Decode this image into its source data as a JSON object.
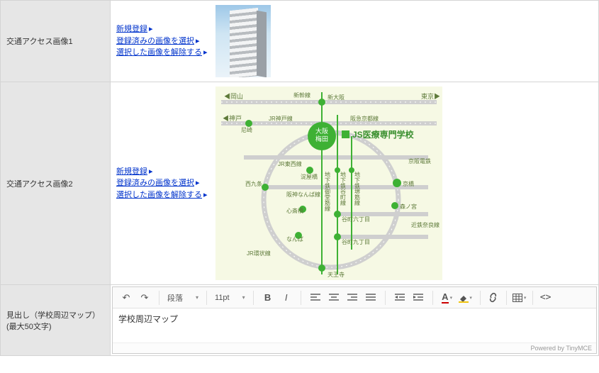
{
  "rows": {
    "access1": {
      "label": "交通アクセス画像1"
    },
    "access2": {
      "label": "交通アクセス画像2"
    },
    "heading": {
      "label": "見出し（学校周辺マップ）(最大50文字)"
    }
  },
  "links": {
    "new": "新規登録",
    "choose": "登録済みの画像を選択",
    "clear": "選択した画像を解除する"
  },
  "editor": {
    "undo": "↶",
    "redo": "↷",
    "para": "段落",
    "size": "11pt",
    "bold": "B",
    "italic": "I",
    "content": "学校周辺マップ",
    "footer": "Powered by TinyMCE"
  },
  "map": {
    "title": "JS医療専門学校",
    "center": "大阪・梅田",
    "dirs": {
      "w": "◀岡山",
      "e": "東京▶",
      "kobe": "◀神戸"
    },
    "lines": {
      "shinkansen": "新幹線",
      "jrkobe": "JR神戸線",
      "hankyu": "阪急京都線",
      "jrtozai": "JR東西線",
      "hanshin": "阪神なんば線",
      "jrkanjo": "JR環状線",
      "keihan": "京阪電鉄",
      "kintetsu": "近鉄奈良線",
      "sub_tanimachi": "地下鉄谷町線",
      "sub_sakaisuji": "地下鉄堺筋線",
      "sub_midosuji": "地下鉄御堂筋線"
    },
    "stations": {
      "shinosaka": "新大阪",
      "amagasaki": "尼崎",
      "yodoyabashi": "淀屋橋",
      "nishikujo": "西九条",
      "shinsaibashi": "心斎橋",
      "namba": "なんば",
      "tennoji": "天王寺",
      "tanimachi6": "谷町六丁目",
      "tanimachi9": "谷町九丁目",
      "kyobashi": "京橋",
      "morinomiya": "森ノ宮"
    }
  }
}
